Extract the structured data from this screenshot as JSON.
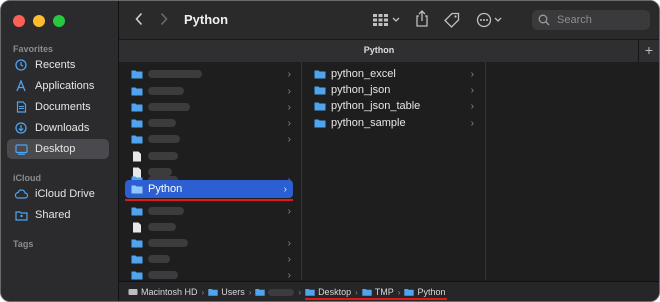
{
  "toolbar": {
    "title": "Python",
    "search_placeholder": "Search"
  },
  "tab": {
    "title": "Python"
  },
  "sidebar": {
    "favorites_label": "Favorites",
    "icloud_label": "iCloud",
    "tags_label": "Tags",
    "favorites": [
      {
        "label": "Recents",
        "icon": "clock-icon"
      },
      {
        "label": "Applications",
        "icon": "applications-icon"
      },
      {
        "label": "Documents",
        "icon": "document-icon"
      },
      {
        "label": "Downloads",
        "icon": "download-icon"
      },
      {
        "label": "Desktop",
        "icon": "desktop-icon",
        "selected": true
      }
    ],
    "icloud": [
      {
        "label": "iCloud Drive",
        "icon": "cloud-icon"
      },
      {
        "label": "Shared",
        "icon": "shared-folder-icon"
      }
    ]
  },
  "column1": {
    "selected_label": "Python"
  },
  "column2": {
    "items": [
      "python_excel",
      "python_json",
      "python_json_table",
      "python_sample"
    ]
  },
  "pathbar": {
    "crumbs": [
      "Macintosh HD",
      "Users",
      "",
      "Desktop",
      "TMP",
      "Python"
    ]
  },
  "colors": {
    "accent": "#2c5fd1",
    "folder": "#4fa4ef",
    "highlight": "#e0191f",
    "traffic_red": "#ff5f57",
    "traffic_yellow": "#febc2e",
    "traffic_green": "#28c840"
  }
}
